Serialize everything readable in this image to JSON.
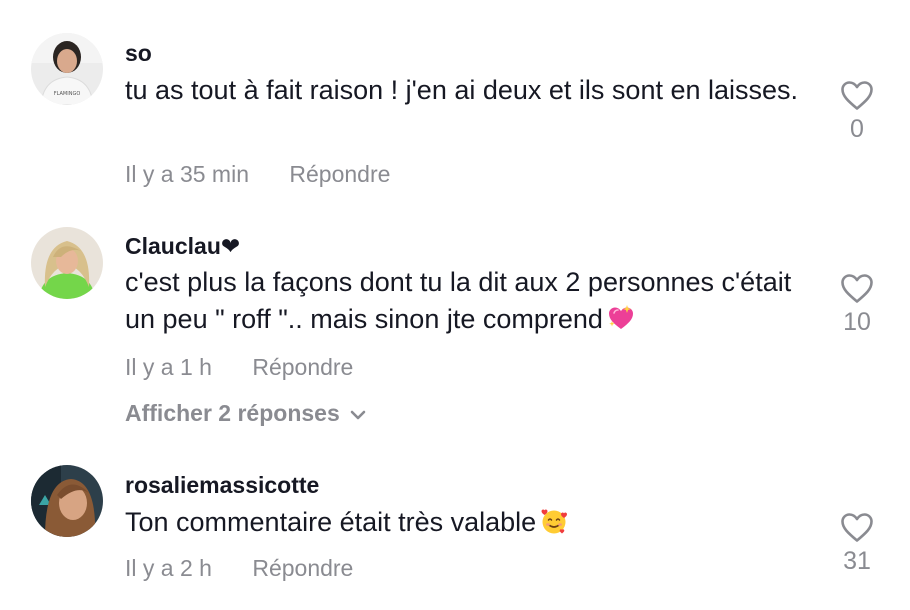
{
  "comments": [
    {
      "username": "so",
      "text": "tu as tout à fait raison ! j'en ai deux et ils sont en laisses.",
      "time": "Il y a 35 min",
      "reply_label": "Répondre",
      "likes": "0",
      "avatar_icon": "user-avatar-woman-white-shirt",
      "shirt_text": "FLAMINGO"
    },
    {
      "username": "Clauclau❤",
      "text": "c'est plus la façons dont tu la dit aux 2 personnes c'était un peu \" roff \".. mais sinon jte comprend",
      "emoji_icon": "sparkling-heart-emoji",
      "time": "Il y a 1 h",
      "reply_label": "Répondre",
      "likes": "10",
      "avatar_icon": "user-avatar-blonde-woman",
      "view_replies_label": "Afficher 2 réponses"
    },
    {
      "username": "rosaliemassicotte",
      "text": "Ton commentaire était très valable",
      "emoji_icon": "smiling-face-with-hearts-emoji",
      "time": "Il y a 2 h",
      "reply_label": "Répondre",
      "likes": "31",
      "avatar_icon": "user-avatar-curly-hair-woman"
    }
  ],
  "colors": {
    "primary_text": "#161823",
    "secondary_text": "#8a8b91",
    "heart_outline": "#8a8b91"
  }
}
